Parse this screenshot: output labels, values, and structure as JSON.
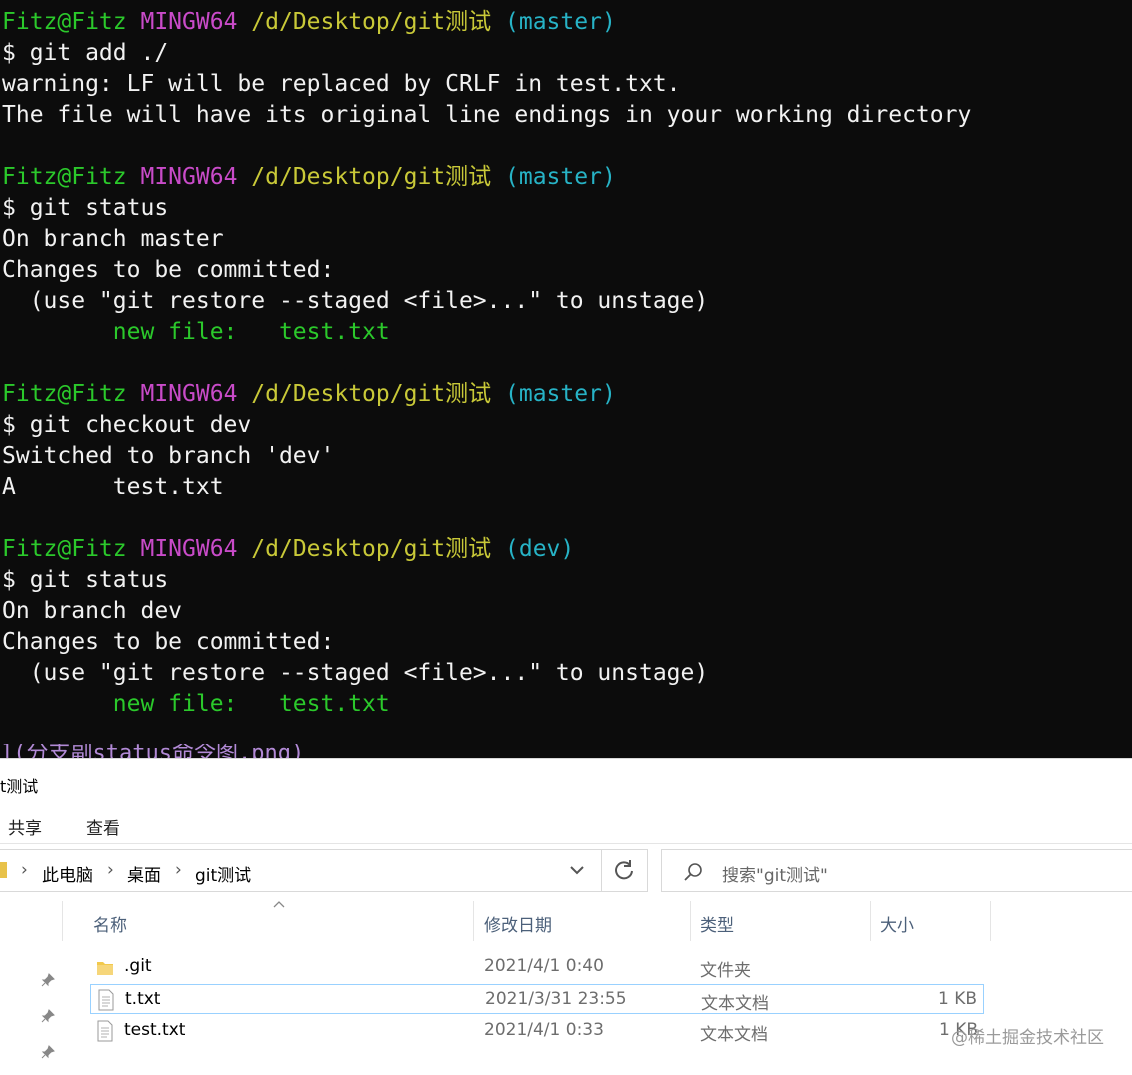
{
  "terminal": {
    "blocks": [
      {
        "prompt": {
          "user": "Fitz@Fitz",
          "env": "MINGW64",
          "path": "/d/Desktop/git测试",
          "branch": "(master)"
        },
        "command": "$ git add ./",
        "output": [
          "warning: LF will be replaced by CRLF in test.txt.",
          "The file will have its original line endings in your working directory"
        ]
      },
      {
        "prompt": {
          "user": "Fitz@Fitz",
          "env": "MINGW64",
          "path": "/d/Desktop/git测试",
          "branch": "(master)"
        },
        "command": "$ git status",
        "output": [
          "On branch master",
          "Changes to be committed:",
          "  (use \"git restore --staged <file>...\" to unstage)"
        ],
        "staged": {
          "label": "        new file:",
          "file": "   test.txt"
        }
      },
      {
        "prompt": {
          "user": "Fitz@Fitz",
          "env": "MINGW64",
          "path": "/d/Desktop/git测试",
          "branch": "(master)"
        },
        "command": "$ git checkout dev",
        "output": [
          "Switched to branch 'dev'",
          "A       test.txt"
        ]
      },
      {
        "prompt": {
          "user": "Fitz@Fitz",
          "env": "MINGW64",
          "path": "/d/Desktop/git测试",
          "branch": "(dev)"
        },
        "command": "$ git status",
        "output": [
          "On branch dev",
          "Changes to be committed:",
          "  (use \"git restore --staged <file>...\" to unstage)"
        ],
        "staged": {
          "label": "        new file:",
          "file": "   test.txt"
        }
      }
    ],
    "cut_text": "](分支副status命令图.png)",
    "colors": {
      "user": "#2bc92b",
      "env": "#c94bc9",
      "path": "#c9c938",
      "branch": "#27b3c6",
      "staged": "#2bc92b",
      "text": "#f2f2f2",
      "background": "#0c0c0c"
    }
  },
  "explorer": {
    "title": "t测试",
    "ribbon_tabs": [
      "共享",
      "查看"
    ],
    "breadcrumb": [
      "此电脑",
      "桌面",
      "git测试"
    ],
    "search_placeholder": "搜索\"git测试\"",
    "columns": [
      "名称",
      "修改日期",
      "类型",
      "大小"
    ],
    "files": [
      {
        "name": ".git",
        "date": "2021/4/1 0:40",
        "type": "文件夹",
        "size": "",
        "icon": "folder-icon"
      },
      {
        "name": "t.txt",
        "date": "2021/3/31 23:55",
        "type": "文本文档",
        "size": "1 KB",
        "icon": "text-file-icon"
      },
      {
        "name": "test.txt",
        "date": "2021/4/1 0:33",
        "type": "文本文档",
        "size": "1 KB",
        "icon": "text-file-icon"
      }
    ],
    "watermark": "@稀土掘金技术社区"
  }
}
